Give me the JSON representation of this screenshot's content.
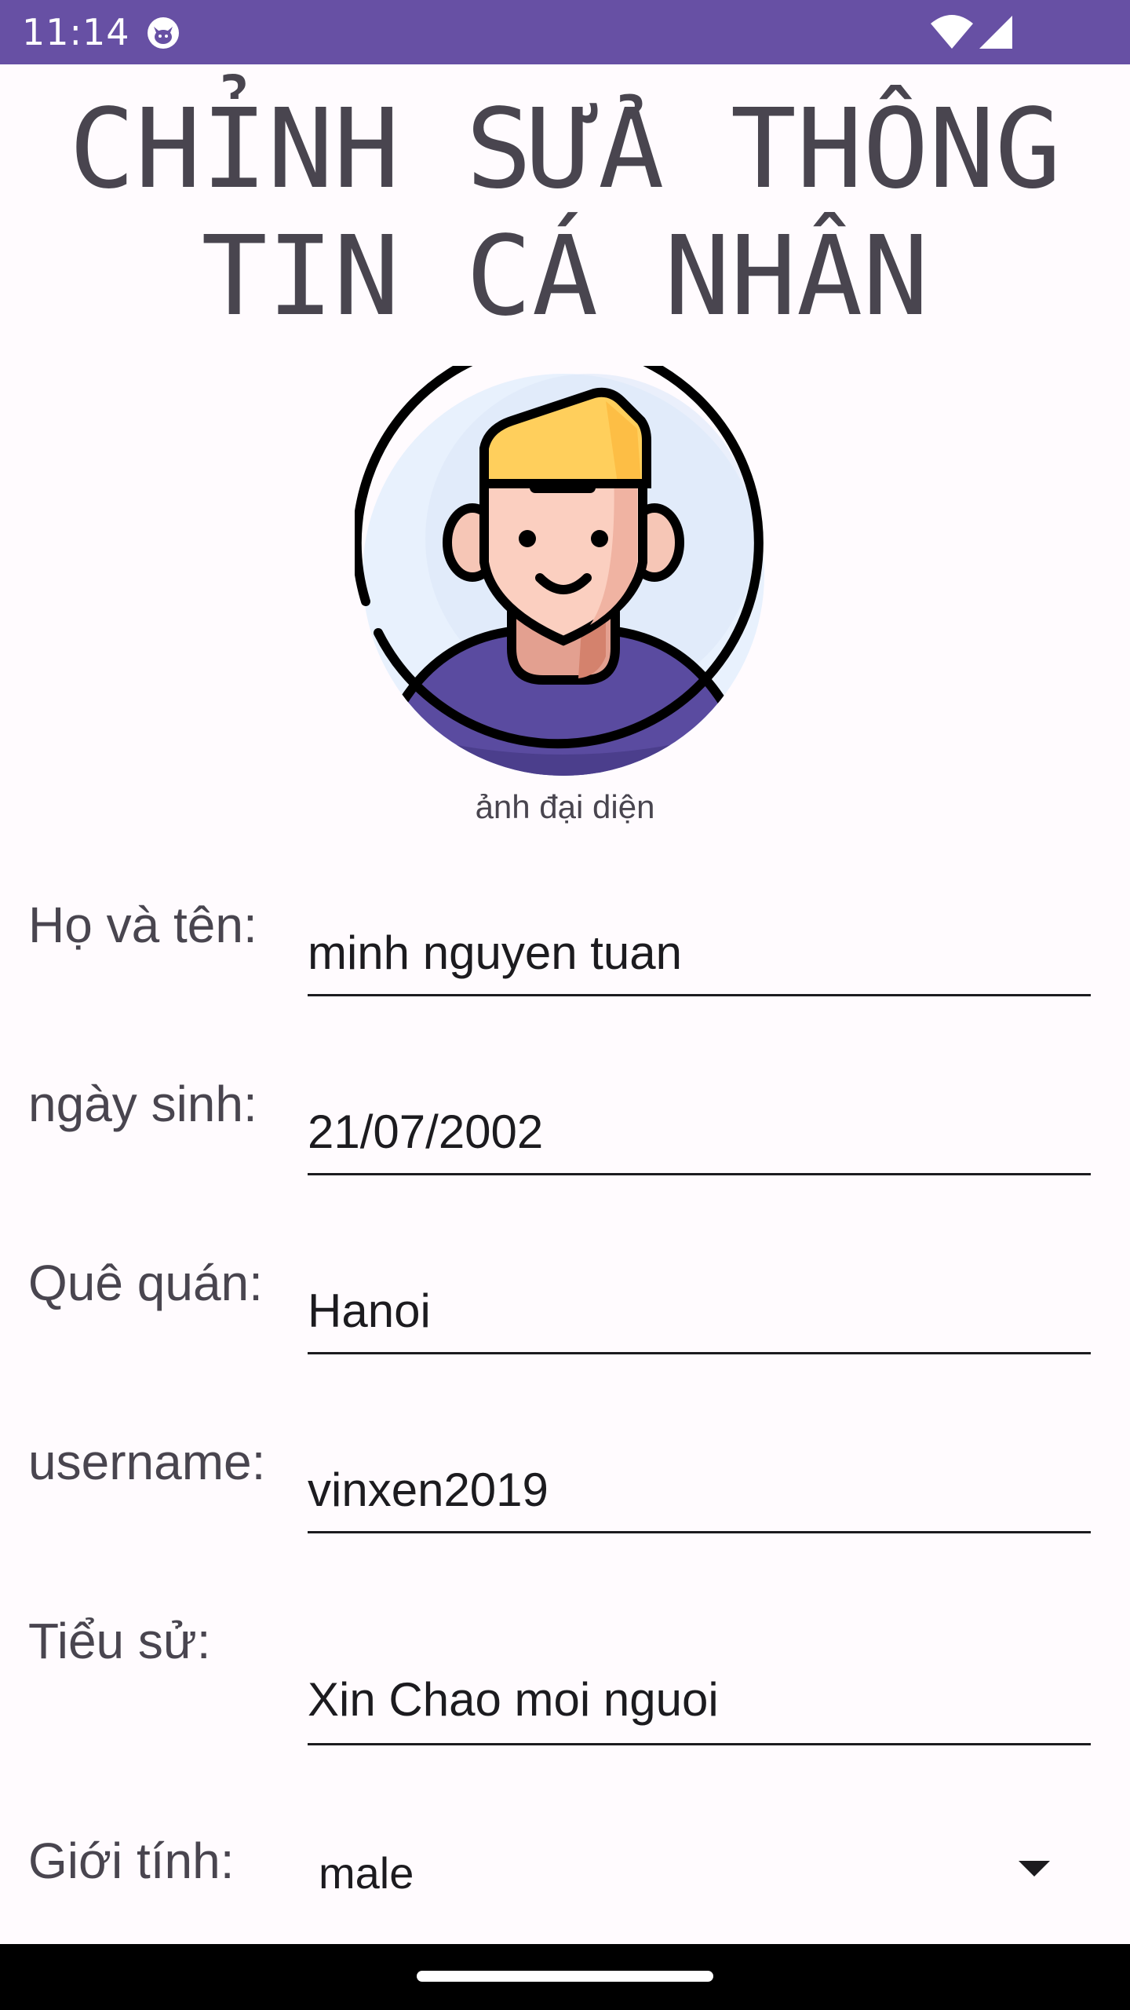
{
  "status_bar": {
    "time": "11:14",
    "background_color": "#6750A4",
    "icons": [
      "cat-notification-icon",
      "wifi-icon",
      "signal-icon"
    ]
  },
  "page": {
    "title": "CHỈNH SỬA THÔNG TIN CÁ NHÂN",
    "title_color": "#49454F",
    "background_color": "#FFFBFE"
  },
  "avatar": {
    "icon": "user-avatar-icon",
    "caption": "ảnh đại diện"
  },
  "form": {
    "fullname": {
      "label": "Họ và tên:",
      "value": "minh nguyen tuan"
    },
    "birthday": {
      "label": "ngày sinh:",
      "value": "21/07/2002"
    },
    "hometown": {
      "label": "Quê quán:",
      "value": "Hanoi"
    },
    "username": {
      "label": "username:",
      "value": "vinxen2019"
    },
    "bio": {
      "label": "Tiểu sử:",
      "value": "Xin Chao moi nguoi"
    },
    "gender": {
      "label": "Giới tính:",
      "selected": "male",
      "icon": "dropdown-arrow-icon"
    }
  }
}
